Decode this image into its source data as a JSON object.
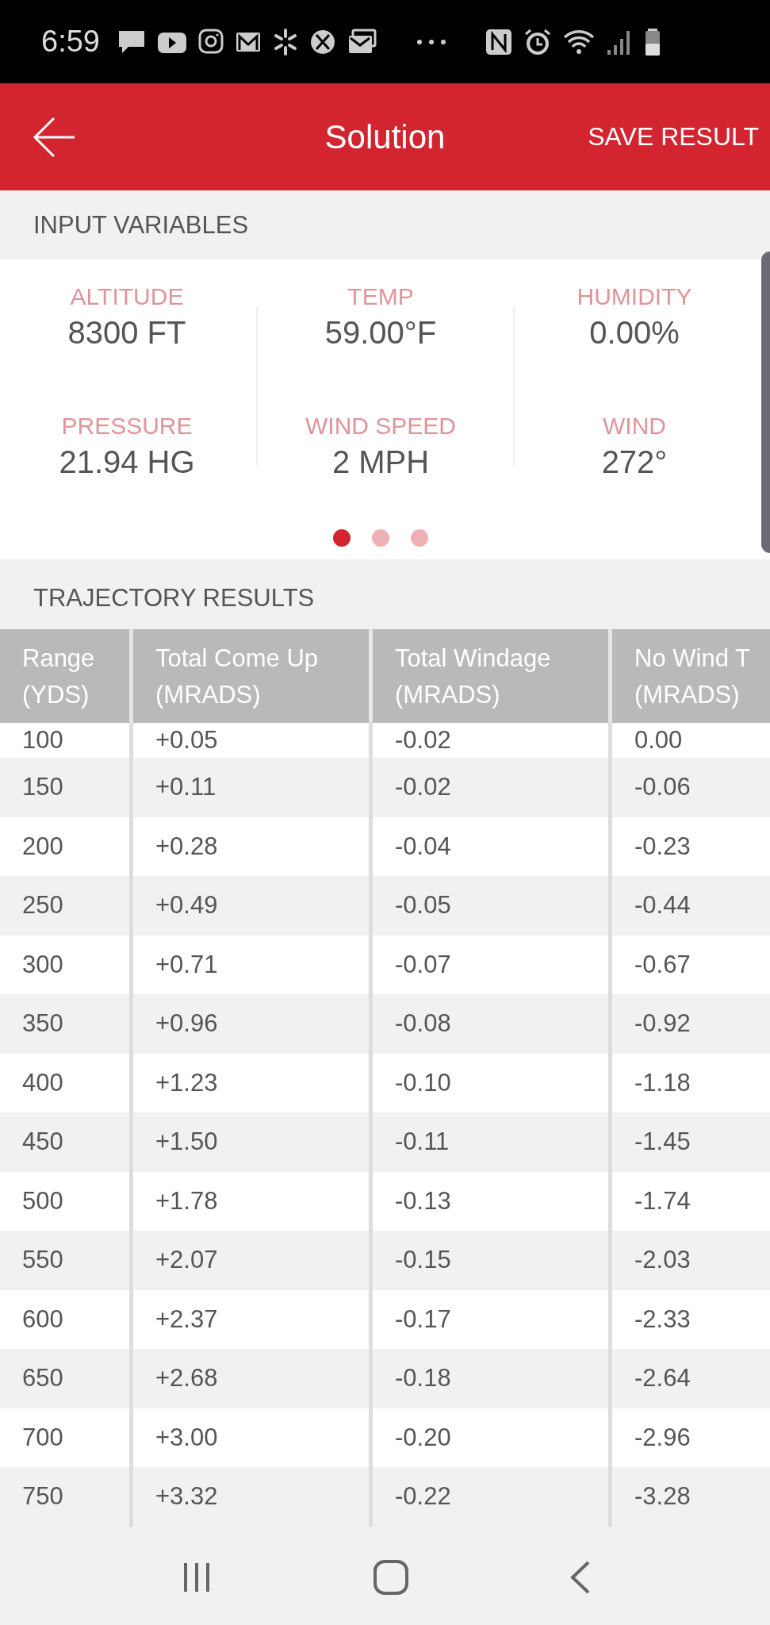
{
  "status_bar": {
    "time": "6:59"
  },
  "header": {
    "title": "Solution",
    "action": "SAVE RESULT"
  },
  "input_variables": {
    "title": "INPUT VARIABLES",
    "items": [
      {
        "label": "ALTITUDE",
        "value": "8300 FT"
      },
      {
        "label": "TEMP",
        "value": "59.00°F"
      },
      {
        "label": "HUMIDITY",
        "value": "0.00%"
      },
      {
        "label": "PRESSURE",
        "value": "21.94 HG"
      },
      {
        "label": "WIND SPEED",
        "value": "2 MPH"
      },
      {
        "label": "WIND",
        "value": "272°"
      }
    ],
    "pages": [
      {
        "selected": true
      },
      {
        "selected": false
      },
      {
        "selected": false
      }
    ]
  },
  "trajectory_results": {
    "title": "TRAJECTORY RESULTS",
    "columns": [
      {
        "title": "Range",
        "unit": "(YDS)"
      },
      {
        "title": "Total Come Up",
        "unit": "(MRADS)"
      },
      {
        "title": "Total Windage",
        "unit": "(MRADS)"
      },
      {
        "title": "No Wind T",
        "unit": "(MRADS)"
      }
    ],
    "rows": [
      [
        "100",
        "+0.05",
        "-0.02",
        "0.00"
      ],
      [
        "150",
        "+0.11",
        "-0.02",
        "-0.06"
      ],
      [
        "200",
        "+0.28",
        "-0.04",
        "-0.23"
      ],
      [
        "250",
        "+0.49",
        "-0.05",
        "-0.44"
      ],
      [
        "300",
        "+0.71",
        "-0.07",
        "-0.67"
      ],
      [
        "350",
        "+0.96",
        "-0.08",
        "-0.92"
      ],
      [
        "400",
        "+1.23",
        "-0.10",
        "-1.18"
      ],
      [
        "450",
        "+1.50",
        "-0.11",
        "-1.45"
      ],
      [
        "500",
        "+1.78",
        "-0.13",
        "-1.74"
      ],
      [
        "550",
        "+2.07",
        "-0.15",
        "-2.03"
      ],
      [
        "600",
        "+2.37",
        "-0.17",
        "-2.33"
      ],
      [
        "650",
        "+2.68",
        "-0.18",
        "-2.64"
      ],
      [
        "700",
        "+3.00",
        "-0.20",
        "-2.96"
      ],
      [
        "750",
        "+3.32",
        "-0.22",
        "-3.28"
      ]
    ]
  }
}
